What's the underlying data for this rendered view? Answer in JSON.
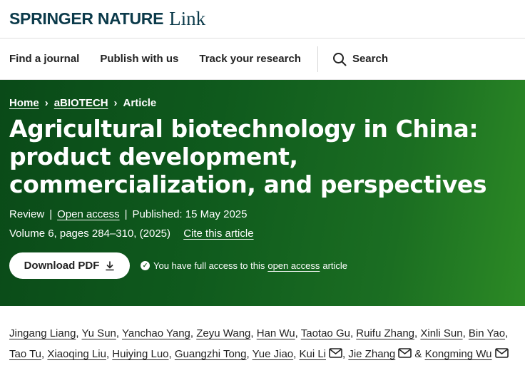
{
  "brand": {
    "name": "SPRINGER NATURE",
    "product": "Link",
    "color": "#0b3a4a"
  },
  "nav": {
    "items": [
      "Find a journal",
      "Publish with us",
      "Track your research"
    ],
    "search_label": "Search"
  },
  "hero": {
    "background": "#0f5a1d",
    "breadcrumb": [
      "Home",
      "aBIOTECH",
      "Article"
    ],
    "title": "Agricultural biotechnology in China: product development, commercialization, and perspectives",
    "article_type": "Review",
    "open_access": "Open access",
    "published": "Published: 15 May 2025",
    "volume": "Volume 6, pages 284–310, (2025)",
    "cite": "Cite this article",
    "download_label": "Download PDF",
    "access_prefix": "You have full access to this",
    "access_link": "open access",
    "access_suffix": "article"
  },
  "authors": [
    {
      "name": "Jingang Liang",
      "sep": ", "
    },
    {
      "name": "Yu Sun",
      "sep": ", "
    },
    {
      "name": "Yanchao Yang",
      "sep": ", "
    },
    {
      "name": "Zeyu Wang",
      "sep": ", "
    },
    {
      "name": "Han Wu",
      "sep": ", "
    },
    {
      "name": "Taotao Gu",
      "sep": ", "
    },
    {
      "name": "Ruifu Zhang",
      "sep": ", "
    },
    {
      "name": "Xinli Sun",
      "sep": ", "
    },
    {
      "name": "Bin Yao",
      "sep": ", "
    },
    {
      "name": "Tao Tu",
      "sep": ", "
    },
    {
      "name": "Xiaoqing Liu",
      "sep": ", "
    },
    {
      "name": "Huiying Luo",
      "sep": ", "
    },
    {
      "name": "Guangzhi Tong",
      "sep": ", "
    },
    {
      "name": "Yue Jiao",
      "sep": ", "
    },
    {
      "name": "Kui Li",
      "sep": ", ",
      "mail": true
    },
    {
      "name": "Jie Zhang",
      "sep": " & ",
      "mail": true
    },
    {
      "name": "Kongming Wu",
      "sep": "",
      "mail": true
    }
  ]
}
